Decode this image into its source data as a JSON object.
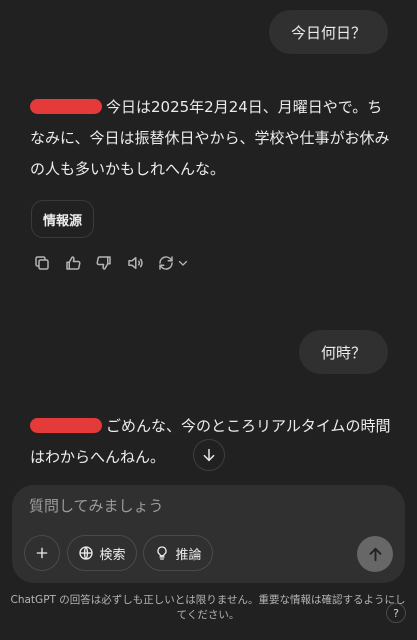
{
  "messages": {
    "user1": "今日何日？",
    "assistant1": "今日は2025年2月24日、月曜日やで。ちなみに、今日は振替休日やから、学校や仕事がお休みの人も多いかもしれへんな。",
    "sources_label": "情報源",
    "user2": "何時？",
    "assistant2": "ごめんな、今のところリアルタイムの時間はわからへんねん。"
  },
  "actions": {
    "icons": [
      "copy-icon",
      "thumbs-up-icon",
      "thumbs-down-icon",
      "read-aloud-icon",
      "regenerate-icon",
      "chevron-down-icon"
    ]
  },
  "composer": {
    "placeholder": "質問してみましょう",
    "search_label": "検索",
    "reason_label": "推論"
  },
  "footer": {
    "disclaimer": "ChatGPT の回答は必ずしも正しいとは限りません。重要な情報は確認するようにしてください。",
    "help": "?"
  },
  "colors": {
    "background": "#212121",
    "bubble": "#303030",
    "redaction": "#e43a3a",
    "send_button": "#676767"
  }
}
